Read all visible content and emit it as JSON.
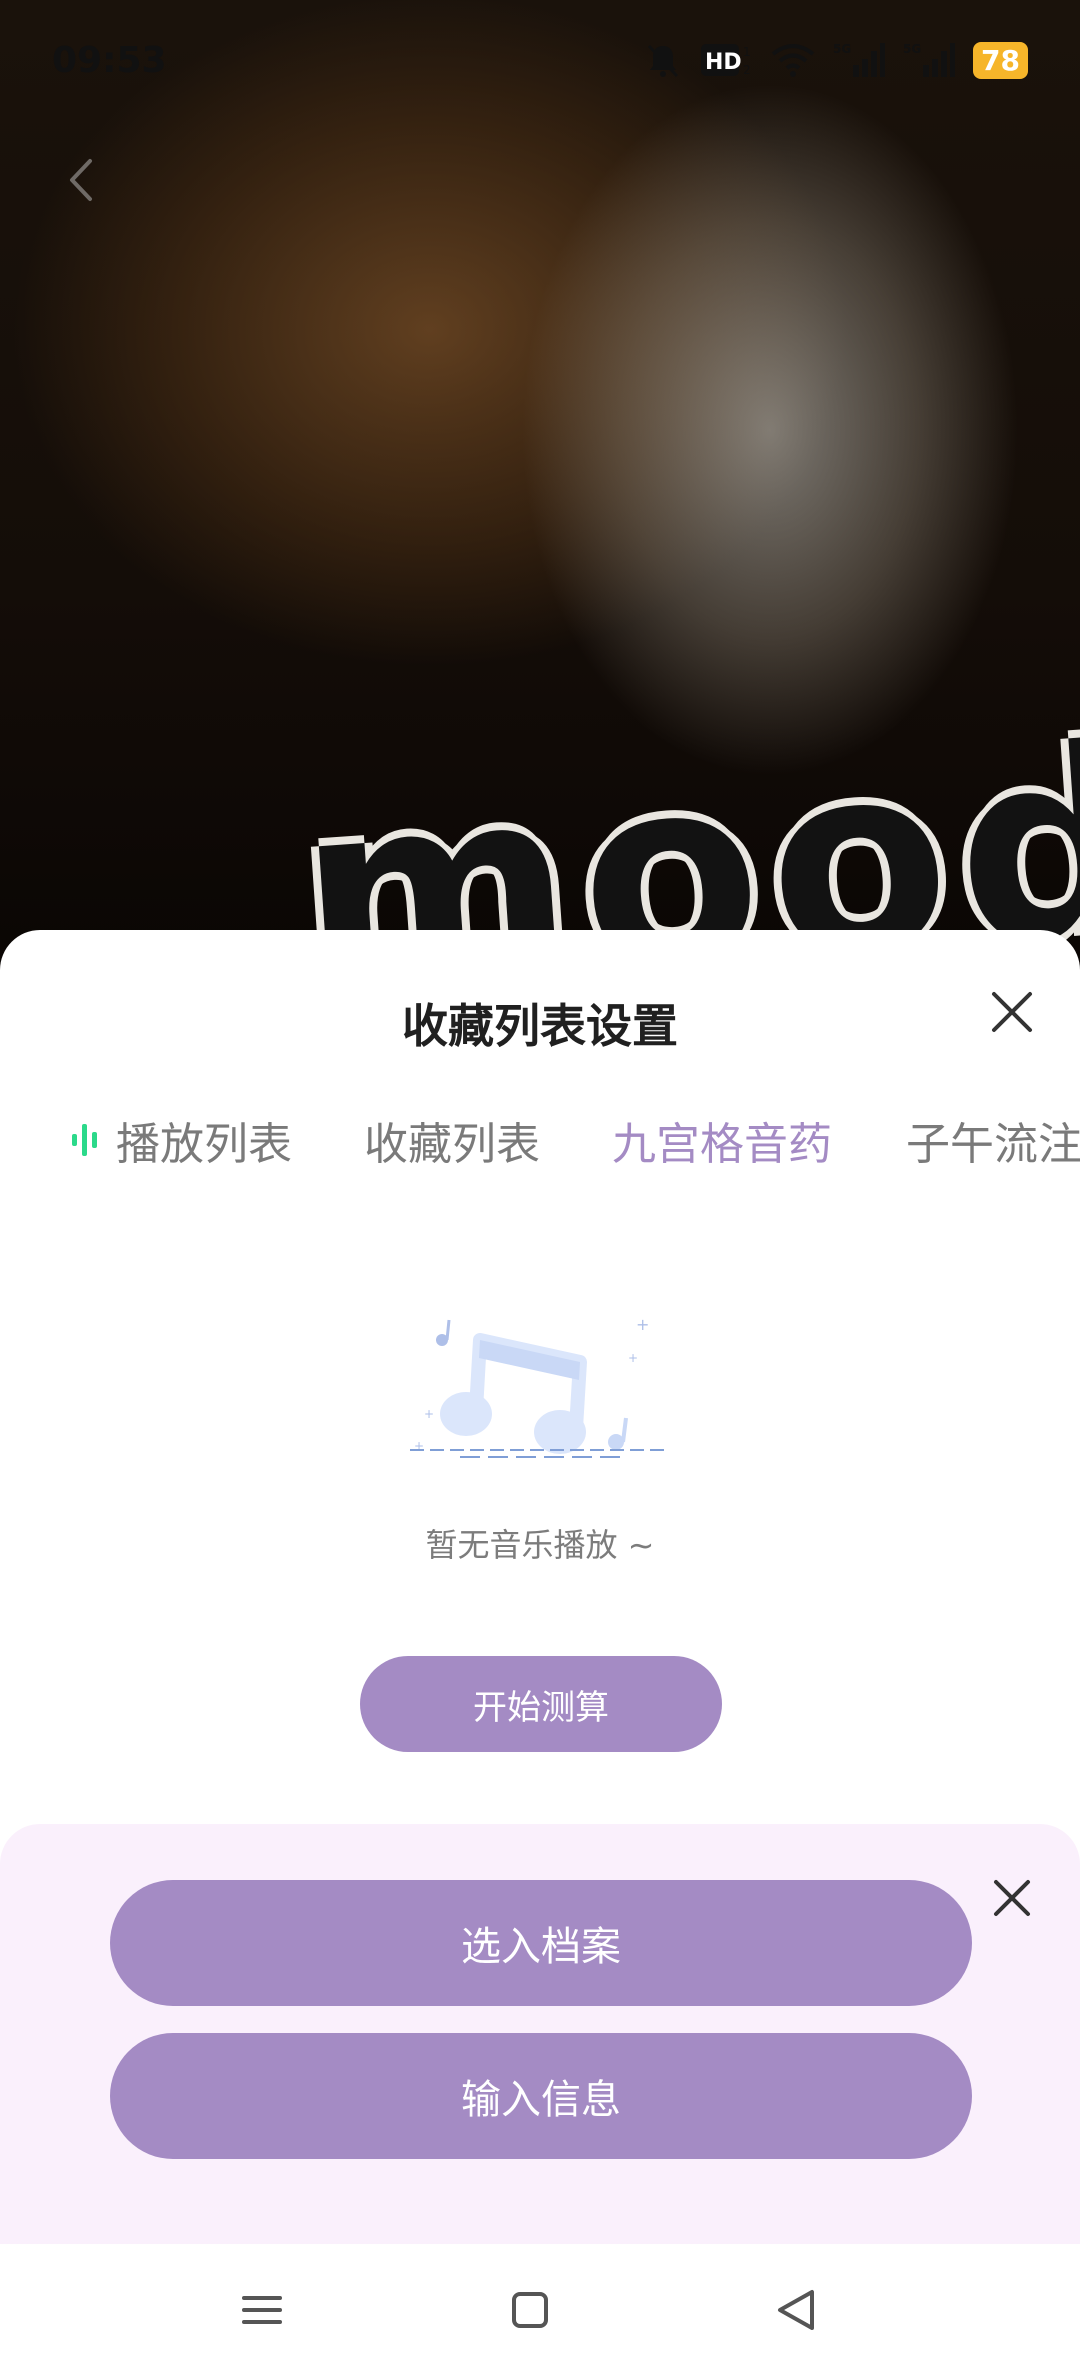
{
  "status_bar": {
    "time": "09:53",
    "icons": [
      "bell-muted-icon",
      "hd-icon",
      "wifi-icon",
      "signal-5g-icon",
      "signal-5g-icon"
    ],
    "battery": "78"
  },
  "colors": {
    "accent": "#a48bc4",
    "panel_bg": "#faf0fc",
    "playing_icon": "#2bd98a",
    "battery": "#f6b52a"
  },
  "sheet": {
    "title": "收藏列表设置",
    "tabs": [
      {
        "label": "播放列表",
        "active": false,
        "icon": "playing-bars-icon"
      },
      {
        "label": "收藏列表",
        "active": false
      },
      {
        "label": "九宫格音药",
        "active": true
      },
      {
        "label": "子午流注",
        "active": false
      }
    ],
    "empty_text": "暂无音乐播放 ~",
    "start_button": "开始测算"
  },
  "archive_panel": {
    "select_button": "选入档案",
    "input_button": "输入信息"
  }
}
